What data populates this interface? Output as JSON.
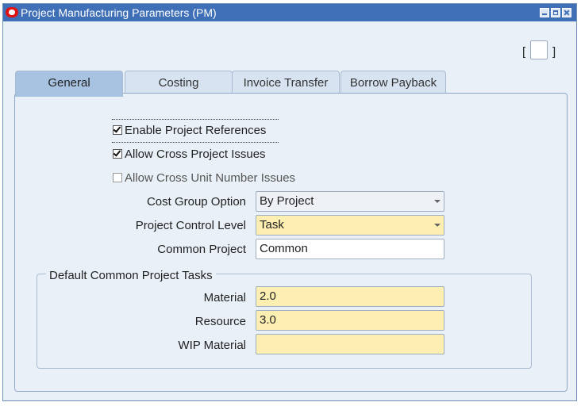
{
  "window": {
    "title": "Project Manufacturing Parameters (PM)"
  },
  "bracket": {
    "left": "[",
    "right": "]"
  },
  "tabs": [
    {
      "label": "General",
      "active": true
    },
    {
      "label": "Costing",
      "active": false
    },
    {
      "label": "Invoice Transfer",
      "active": false
    },
    {
      "label": "Borrow Payback",
      "active": false
    }
  ],
  "checkboxes": {
    "enable_project_references": {
      "label": "Enable Project References",
      "checked": true
    },
    "allow_cross_project_issues": {
      "label": "Allow Cross Project Issues",
      "checked": true
    },
    "allow_cross_unit_number_issues": {
      "label": "Allow Cross Unit Number Issues",
      "checked": false
    }
  },
  "fields": {
    "cost_group_option": {
      "label": "Cost Group Option",
      "value": "By Project"
    },
    "project_control_level": {
      "label": "Project Control Level",
      "value": "Task"
    },
    "common_project": {
      "label": "Common Project",
      "value": "Common"
    }
  },
  "default_tasks": {
    "title": "Default Common Project Tasks",
    "material": {
      "label": "Material",
      "value": "2.0"
    },
    "resource": {
      "label": "Resource",
      "value": "3.0"
    },
    "wip_material": {
      "label": "WIP Material",
      "value": ""
    }
  },
  "colors": {
    "titlebar": "#3f6fb6",
    "required_field": "#fdeeb2",
    "active_tab": "#a8c3e2"
  }
}
